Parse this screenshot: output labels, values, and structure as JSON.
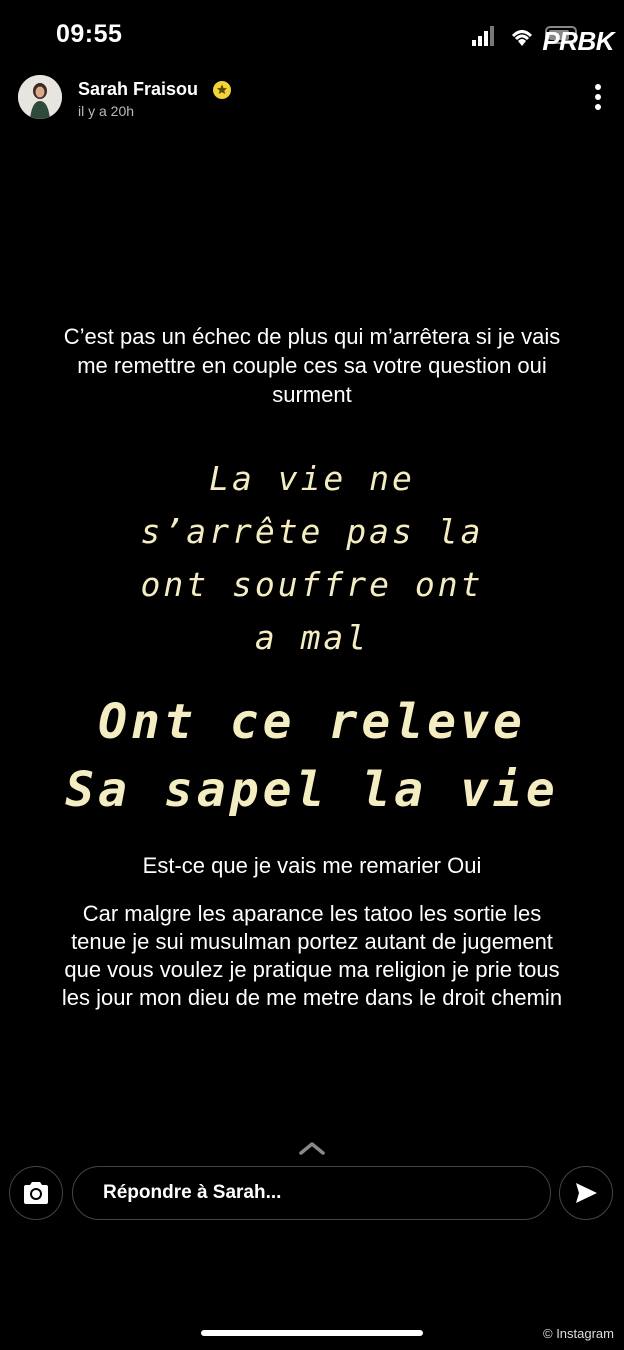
{
  "status_bar": {
    "time": "09:55",
    "watermark": "PRBK"
  },
  "profile": {
    "name": "Sarah Fraisou",
    "time_ago": "il y a 20h"
  },
  "story": {
    "caption_top": [
      "C’est pas un échec de plus qui m’arrêtera si je vais",
      "me remettre en couple ces sa votre question oui",
      "surment"
    ],
    "quote_small": [
      "La vie ne",
      "s’arrête pas la",
      "ont souffre ont",
      "a mal"
    ],
    "quote_large": [
      "Ont ce releve",
      "Sa sapel la vie"
    ],
    "question": "Est-ce que je vais me remarier Oui",
    "caption_bottom": [
      "Car malgre les aparance les tatoo les sortie les",
      "tenue je sui musulman portez autant de jugement",
      "que vous voulez je pratique ma religion je prie tous",
      "les jour mon dieu de me metre dans le droit chemin"
    ]
  },
  "reply": {
    "placeholder": "Répondre à Sarah..."
  },
  "credit": "© Instagram",
  "colors": {
    "quote_text": "#f5edc2",
    "verified_badge": "#f2d23b"
  }
}
